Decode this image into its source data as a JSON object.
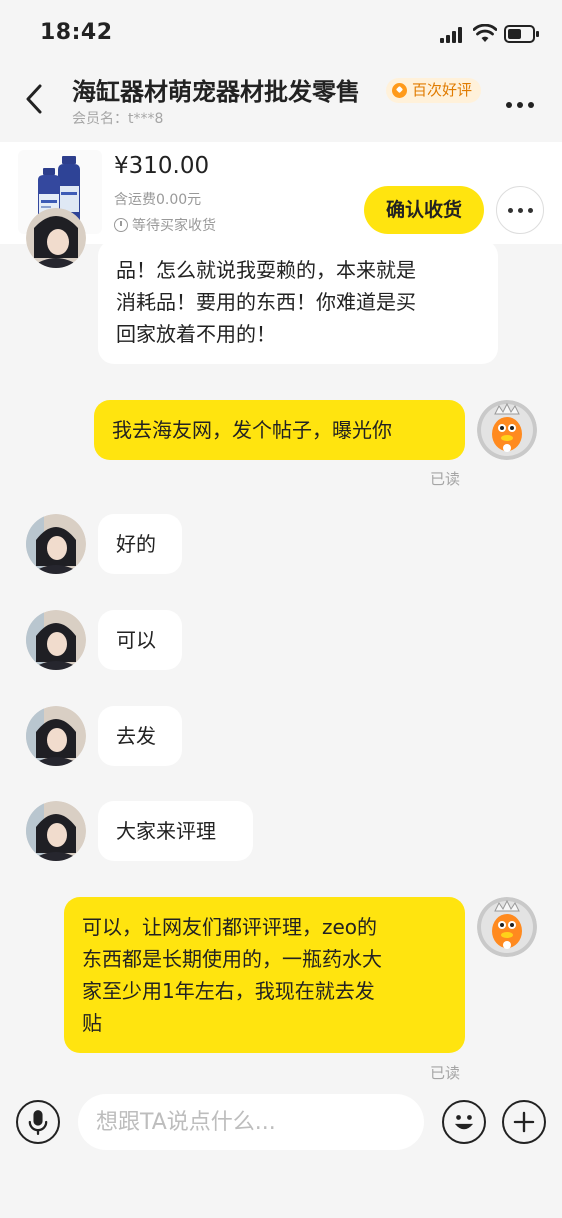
{
  "status_bar": {
    "time": "18:42"
  },
  "header": {
    "title": "海缸器材萌宠器材批发零售",
    "badge": "百次好评",
    "member": "会员名：t***8"
  },
  "order": {
    "price": "¥310.00",
    "shipping": "含运费0.00元",
    "status": "等待买家收货",
    "confirm_label": "确认收货"
  },
  "messages": [
    {
      "side": "left",
      "lines": [
        "品！怎么就说我耍赖的，本来就是",
        "消耗品！要用的东西！你难道是买",
        "回家放着不用的！"
      ]
    },
    {
      "side": "right",
      "lines": [
        "我去海友网，发个帖子，曝光你"
      ],
      "read": "已读"
    },
    {
      "side": "left",
      "lines": [
        "好的"
      ]
    },
    {
      "side": "left",
      "lines": [
        "可以"
      ]
    },
    {
      "side": "left",
      "lines": [
        "去发"
      ]
    },
    {
      "side": "left",
      "lines": [
        "大家来评理"
      ]
    },
    {
      "side": "right",
      "lines": [
        "可以，让网友们都评评理，zeo的",
        "东西都是长期使用的，一瓶药水大",
        "家至少用1年左右，我现在就去发",
        "贴"
      ],
      "read": "已读"
    }
  ],
  "input": {
    "placeholder": "想跟TA说点什么..."
  },
  "colors": {
    "accent": "#ffe40f",
    "background": "#f5f5f5",
    "badge_text": "#e07b00"
  },
  "icons": [
    "back-icon",
    "more-icon",
    "clock-icon",
    "microphone-icon",
    "emoji-icon",
    "plus-icon",
    "star-badge-icon"
  ]
}
